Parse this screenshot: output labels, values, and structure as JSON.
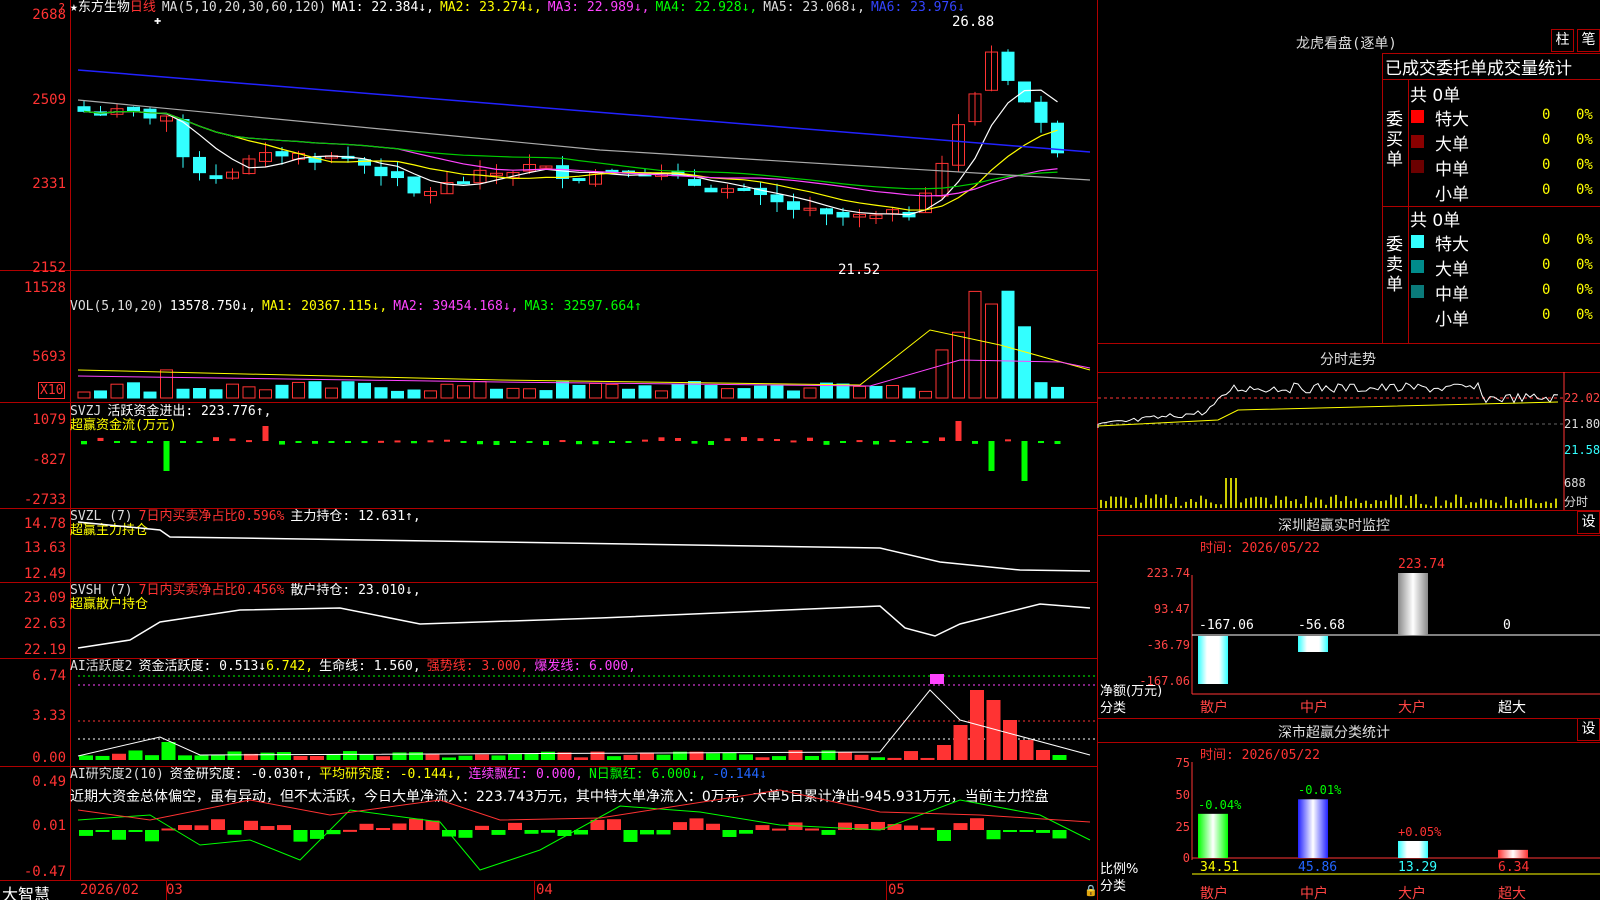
{
  "colors": {
    "red": "#ff3333",
    "cyan": "#33ffff",
    "green": "#00ff00",
    "yellow": "#ffff00",
    "magenta": "#ff44ff",
    "white": "#ffffff",
    "blue": "#2222ff",
    "grid": "#b00000"
  },
  "main": {
    "title": "东方生物",
    "period": "日线",
    "ma_spec": "MA(5,10,20,30,60,120)",
    "ma1": "MA1: 22.384↓,",
    "ma2": "MA2: 23.274↓,",
    "ma3": "MA3: 22.989↓,",
    "ma4": "MA4: 22.928↓,",
    "ma5": "MA5: 23.068↓,",
    "ma6": "MA6: 23.976↓",
    "high_label": "26.88",
    "low_label": "21.52",
    "yticks": [
      "2688",
      "2509",
      "2331",
      "2152"
    ],
    "marker": "?",
    "star": "★"
  },
  "vol": {
    "spec": "VOL(5,10,20)",
    "value": "13578.750↓,",
    "ma1": "MA1: 20367.115↓,",
    "ma2": "MA2: 39454.168↓,",
    "ma3": "MA3: 32597.664↑",
    "yticks": [
      "11528",
      "5693"
    ],
    "unit": "X10"
  },
  "svzj": {
    "spec": "SVZJ",
    "text": "活跃资金进出: 223.776↑,",
    "subtitle": "超赢资金流(万元)",
    "yticks": [
      "1079",
      "-827",
      "-2733"
    ]
  },
  "svzl": {
    "spec": "SVZL (7)",
    "text1": "7日内买卖净占比0.596%",
    "text2": "主力持仓: 12.631↑,",
    "subtitle": "超赢主力持仓",
    "yticks": [
      "14.78",
      "13.63",
      "12.49"
    ]
  },
  "svsh": {
    "spec": "SVSH (7)",
    "text1": "7日内买卖净占比0.456%",
    "text2": "散户持仓: 23.010↓,",
    "subtitle": "超赢散户持仓",
    "yticks": [
      "23.09",
      "22.63",
      "22.19"
    ]
  },
  "ai1": {
    "spec": "AI活跃度2",
    "t1": "资金活跃度: 0.513↓",
    "t2": "6.742,",
    "t3": "生命线: 1.560,",
    "t4": "强势线: 3.000,",
    "t5": "爆发线: 6.000,",
    "yticks": [
      "6.74",
      "3.33",
      "0.00"
    ]
  },
  "ai2": {
    "spec": "AI研究度2(10)",
    "t1": "资金研究度: -0.030↑,",
    "t2": "平均研究度: -0.144↓,",
    "t3": "连续飘红: 0.000,",
    "t4": "N日飘红: 6.000↓,",
    "t5": "-0.144↓",
    "comment": "近期大资金总体偏空，虽有异动，但不太活跃，今日大单净流入：223.743万元，其中特大单净流入：0万元，大单5日累计净出-945.931万元，当前主力控盘",
    "yticks": [
      "0.49",
      "0.01",
      "-0.47"
    ]
  },
  "xaxis": {
    "labels": [
      "2026/02",
      "03",
      "04",
      "05"
    ],
    "brand": "大智慧"
  },
  "longhu": {
    "title": "龙虎看盘(逐单)",
    "btn1": "柱",
    "btn2": "笔",
    "header": "已成交委托单成交量统计",
    "buy_label": "委买单",
    "sell_label": "委卖单",
    "buy_total": "共 0单",
    "sell_total": "共 0单",
    "buy_rows": [
      {
        "name": "特大",
        "count": "0",
        "pct": "0%"
      },
      {
        "name": "大单",
        "count": "0",
        "pct": "0%"
      },
      {
        "name": "中单",
        "count": "0",
        "pct": "0%"
      },
      {
        "name": "小单",
        "count": "0",
        "pct": "0%"
      }
    ],
    "sell_rows": [
      {
        "name": "特大",
        "count": "0",
        "pct": "0%"
      },
      {
        "name": "大单",
        "count": "0",
        "pct": "0%"
      },
      {
        "name": "中单",
        "count": "0",
        "pct": "0%"
      },
      {
        "name": "小单",
        "count": "0",
        "pct": "0%"
      }
    ]
  },
  "fenshi": {
    "title": "分时走势",
    "yticks": [
      "22.02",
      "21.80",
      "21.58"
    ],
    "vol_tick": "688",
    "vol_label": "分时"
  },
  "sz_monitor": {
    "title": "深圳超赢实时监控",
    "btn": "设",
    "time": "时间: 2026/05/22",
    "yticks": [
      "223.74",
      "93.47",
      "-36.79",
      "-167.06"
    ],
    "axis_label": "净额(万元)",
    "cat_label": "分类",
    "categories": [
      "散户",
      "中户",
      "大户",
      "超大"
    ],
    "values": [
      "-167.06",
      "-56.68",
      "223.74",
      "0"
    ]
  },
  "sz_class": {
    "title": "深市超赢分类统计",
    "btn": "设",
    "time": "时间: 2026/05/22",
    "yticks": [
      "75",
      "50",
      "25",
      "0"
    ],
    "axis_label": "比例%",
    "cat_label": "分类",
    "categories": [
      "散户",
      "中户",
      "大户",
      "超大"
    ],
    "values": [
      "34.51",
      "45.86",
      "13.29",
      "6.34"
    ],
    "changes": [
      "-0.04%",
      "-0.01%",
      "+0.05%",
      ""
    ]
  },
  "chart_data": [
    {
      "type": "candlestick",
      "title": "东方生物 日线",
      "ylim": [
        21.52,
        26.88
      ],
      "yticks": [
        21.52,
        23.31,
        25.09,
        26.88
      ],
      "high": 26.88,
      "low": 21.52
    },
    {
      "type": "bar",
      "title": "VOL(5,10,20)",
      "ylim": [
        0,
        11528
      ]
    },
    {
      "type": "bar",
      "title": "SVZJ 超赢资金流(万元)",
      "ylim": [
        -2733,
        1079
      ]
    },
    {
      "type": "line",
      "title": "SVZL 超赢主力持仓",
      "ylim": [
        12.49,
        14.78
      ]
    },
    {
      "type": "line",
      "title": "SVSH 超赢散户持仓",
      "ylim": [
        22.19,
        23.09
      ]
    },
    {
      "type": "bar",
      "title": "AI活跃度2",
      "ylim": [
        0,
        6.74
      ]
    },
    {
      "type": "bar",
      "title": "AI研究度2(10)",
      "ylim": [
        -0.47,
        0.49
      ]
    },
    {
      "type": "bar",
      "title": "深圳超赢实时监控",
      "categories": [
        "散户",
        "中户",
        "大户",
        "超大"
      ],
      "values": [
        -167.06,
        -56.68,
        223.74,
        0
      ],
      "ylim": [
        -167.06,
        223.74
      ]
    },
    {
      "type": "bar",
      "title": "深市超赢分类统计",
      "categories": [
        "散户",
        "中户",
        "大户",
        "超大"
      ],
      "values": [
        34.51,
        45.86,
        13.29,
        6.34
      ],
      "ylim": [
        0,
        75
      ]
    }
  ]
}
